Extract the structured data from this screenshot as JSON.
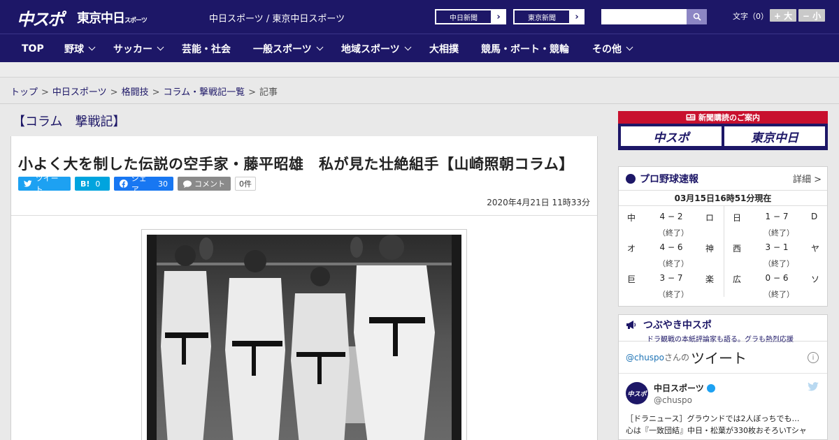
{
  "header": {
    "logo_chuspo": "中スポ",
    "logo_tokyo": "東京中日",
    "logo_tokyo_small": "スポーツ",
    "site_name": "中日スポーツ / 東京中日スポーツ",
    "ext_links": [
      {
        "label": "中日新聞",
        "arrow": "›"
      },
      {
        "label": "東京新聞",
        "arrow": "›"
      }
    ],
    "search": {
      "value": "",
      "placeholder": ""
    },
    "font_size_label": "文字（0）",
    "font_up": "+ 大",
    "font_down": "− 小"
  },
  "nav": [
    {
      "label": "TOP",
      "dropdown": false
    },
    {
      "label": "野球",
      "dropdown": true
    },
    {
      "label": "サッカー",
      "dropdown": true
    },
    {
      "label": "芸能・社会",
      "dropdown": false
    },
    {
      "label": "一般スポーツ",
      "dropdown": true
    },
    {
      "label": "地域スポーツ",
      "dropdown": true
    },
    {
      "label": "大相撲",
      "dropdown": false
    },
    {
      "label": "競馬・ボート・競輪",
      "dropdown": false
    },
    {
      "label": "その他",
      "dropdown": true
    }
  ],
  "breadcrumb": {
    "items": [
      "トップ",
      "中日スポーツ",
      "格闘技",
      "コラム・撃戦記一覧"
    ],
    "current": "記事",
    "sep": ">"
  },
  "section_title": "【コラム　撃戦記】",
  "article": {
    "headline": "小よく大を制した伝説の空手家・藤平昭雄　私が見た壮絶組手【山崎照朝コラム】",
    "share": {
      "tweet": "ツイート",
      "hatena": "B!",
      "hatena_count": "0",
      "facebook": "シェア",
      "facebook_count": "30",
      "comment": "コメント",
      "comment_count": "0件"
    },
    "datetime": "2020年4月21日 11時33分"
  },
  "sidebar": {
    "subscribe": {
      "title": "新聞購読のご案内",
      "logo1": "中スポ",
      "logo2": "東京中日"
    },
    "baseball": {
      "title": "プロ野球速報",
      "more": "詳細 >",
      "time": "03月15日16時51分現在",
      "games_left": [
        {
          "t1": "中",
          "score": "4 − 2",
          "t2": "ロ",
          "status": "（終了）"
        },
        {
          "t1": "オ",
          "score": "4 − 6",
          "t2": "神",
          "status": "（終了）"
        },
        {
          "t1": "巨",
          "score": "3 − 7",
          "t2": "楽",
          "status": "（終了）"
        }
      ],
      "games_right": [
        {
          "t1": "日",
          "score": "1 − 7",
          "t2": "D",
          "status": "（終了）"
        },
        {
          "t1": "西",
          "score": "3 − 1",
          "t2": "ヤ",
          "status": "（終了）"
        },
        {
          "t1": "広",
          "score": "0 − 6",
          "t2": "ソ",
          "status": "（終了）"
        }
      ]
    },
    "tsubuyaki": {
      "title": "つぶやき中スポ",
      "subtitle": "ドラ観戦の本紙評論家も語る。グラも熱烈応援",
      "handle": "@chuspo",
      "san": "さんの",
      "tweet_word": "ツイート",
      "info": "i",
      "account_name": "中日スポーツ",
      "account_handle": "@chuspo",
      "avatar": "中スポ",
      "tweet_line1": "［ドラニュース］グラウンドでは2人ぼっちでも…",
      "tweet_line2": "心は『一致団結』中日・松葉が330枚おそろいTシャ"
    }
  }
}
